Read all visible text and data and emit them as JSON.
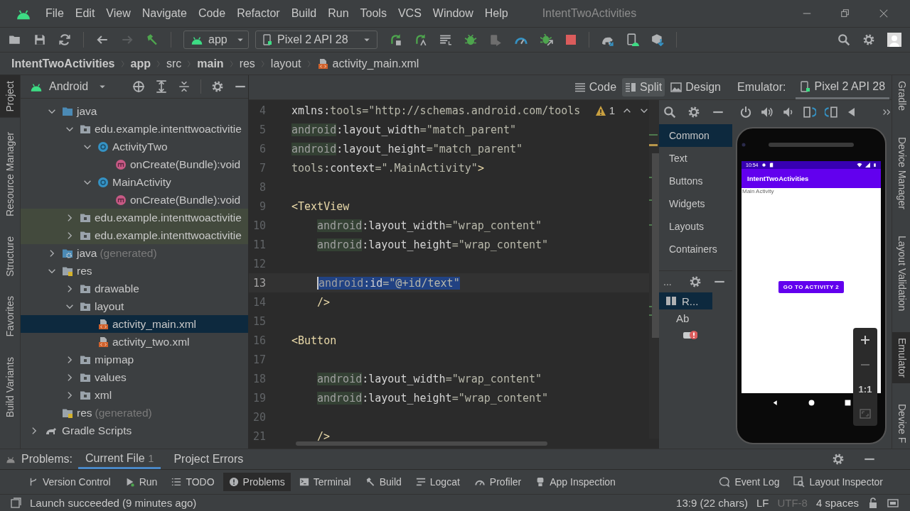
{
  "window": {
    "title": "IntentTwoActivities",
    "menu": [
      "File",
      "Edit",
      "View",
      "Navigate",
      "Code",
      "Refactor",
      "Build",
      "Run",
      "Tools",
      "VCS",
      "Window",
      "Help"
    ]
  },
  "toolbar": {
    "run_config": "app",
    "device": "Pixel 2 API 28"
  },
  "breadcrumb": [
    {
      "text": "IntentTwoActivities",
      "bold": true
    },
    {
      "text": "app",
      "bold": true
    },
    {
      "text": "src",
      "bold": false
    },
    {
      "text": "main",
      "bold": true
    },
    {
      "text": "res",
      "bold": false
    },
    {
      "text": "layout",
      "bold": false
    },
    {
      "text": "activity_main.xml",
      "bold": false,
      "kind": "xml"
    }
  ],
  "left_tabs": [
    {
      "label": "Project",
      "selected": true
    },
    {
      "label": "Resource Manager",
      "selected": false
    },
    {
      "label": "Structure",
      "selected": false
    },
    {
      "label": "Favorites",
      "selected": false
    },
    {
      "label": "Build Variants",
      "selected": false
    }
  ],
  "project": {
    "view": "Android",
    "tree": [
      {
        "children": [
          {
            "label": "java",
            "kind": "folder",
            "expanded": true,
            "selected": false,
            "children": [
              {
                "label": "edu.example.intenttwoactivitie",
                "kind": "package",
                "expanded": true,
                "selected": false,
                "children": [
                  {
                    "label": "ActivityTwo",
                    "kind": "class",
                    "expanded": true,
                    "selected": false,
                    "children": [
                      {
                        "label": "onCreate(Bundle):void",
                        "kind": "method",
                        "selected": false
                      }
                    ]
                  },
                  {
                    "label": "MainActivity",
                    "kind": "class",
                    "expanded": true,
                    "selected": false,
                    "children": [
                      {
                        "label": "onCreate(Bundle):void",
                        "kind": "method",
                        "selected": false
                      }
                    ]
                  }
                ]
              },
              {
                "label": "edu.example.intenttwoactivitie",
                "kind": "test_package",
                "expanded": false,
                "selected": false
              },
              {
                "label": "edu.example.intenttwoactivitie",
                "kind": "test_package",
                "expanded": false,
                "selected": false
              }
            ]
          },
          {
            "label": "java",
            "note": "(generated)",
            "kind": "generated_folder",
            "expanded": false,
            "selected": false
          },
          {
            "label": "res",
            "kind": "res_folder",
            "expanded": true,
            "selected": false,
            "children": [
              {
                "label": "drawable",
                "kind": "package",
                "expanded": false,
                "selected": false
              },
              {
                "label": "layout",
                "kind": "package",
                "expanded": true,
                "selected": false,
                "children": [
                  {
                    "label": "activity_main.xml",
                    "kind": "xml",
                    "selected": true
                  },
                  {
                    "label": "activity_two.xml",
                    "kind": "xml",
                    "selected": false
                  }
                ]
              },
              {
                "label": "mipmap",
                "kind": "package",
                "expanded": false,
                "selected": false
              },
              {
                "label": "values",
                "kind": "package",
                "expanded": false,
                "selected": false
              },
              {
                "label": "xml",
                "kind": "package",
                "expanded": false,
                "selected": false
              }
            ]
          },
          {
            "label": "res",
            "note": "(generated)",
            "kind": "res_folder",
            "selected": false
          }
        ]
      },
      {
        "label": "Gradle Scripts",
        "kind": "gradle",
        "expanded": false,
        "selected": false
      }
    ]
  },
  "editor": {
    "view_modes": [
      {
        "label": "Code",
        "kind": "code",
        "selected": false
      },
      {
        "label": "Split",
        "kind": "split",
        "selected": true
      },
      {
        "label": "Design",
        "kind": "design",
        "selected": false
      }
    ],
    "warnings": "1",
    "lines": [
      {
        "number": "4",
        "selected": false,
        "tokens": [
          {
            "kind": "attr",
            "text": "xmlns:"
          },
          {
            "kind": "value",
            "text": "tools=\"http://schemas.android.com/tools"
          }
        ]
      },
      {
        "number": "5",
        "selected": false,
        "tokens": [
          {
            "kind": "ns",
            "text": "android"
          },
          {
            "kind": "attr",
            "text": ":layout_width"
          },
          {
            "kind": "value",
            "text": "=\"match_parent\""
          }
        ]
      },
      {
        "number": "6",
        "selected": false,
        "tokens": [
          {
            "kind": "ns",
            "text": "android"
          },
          {
            "kind": "attr",
            "text": ":layout_height"
          },
          {
            "kind": "value",
            "text": "=\"match_parent\""
          }
        ]
      },
      {
        "number": "7",
        "selected": false,
        "tokens": [
          {
            "kind": "value",
            "text": "tools"
          },
          {
            "kind": "attr",
            "text": ":context"
          },
          {
            "kind": "value",
            "text": "=\".MainActivity\""
          },
          {
            "kind": "tag",
            "text": ">"
          }
        ]
      },
      {
        "number": "8",
        "selected": false
      },
      {
        "number": "9",
        "selected": false,
        "tokens": [
          {
            "kind": "tag",
            "text": "<TextView"
          }
        ]
      },
      {
        "number": "10",
        "selected": false,
        "indented": true,
        "tokens": [
          {
            "kind": "ns",
            "text": "android"
          },
          {
            "kind": "attr",
            "text": ":layout_width"
          },
          {
            "kind": "value",
            "text": "=\"wrap_content\""
          }
        ]
      },
      {
        "number": "11",
        "selected": false,
        "indented": true,
        "tokens": [
          {
            "kind": "ns",
            "text": "android"
          },
          {
            "kind": "attr",
            "text": ":layout_height"
          },
          {
            "kind": "value",
            "text": "=\"wrap_content\""
          }
        ]
      },
      {
        "number": "12",
        "selected": false
      },
      {
        "number": "13",
        "selected": true,
        "indented": true,
        "tokens": [
          {
            "kind": "ns",
            "text": "android"
          },
          {
            "kind": "attr",
            "text": ":id"
          },
          {
            "kind": "value",
            "text": "=\"@+id/text\""
          }
        ]
      },
      {
        "number": "14",
        "selected": false,
        "indented": true,
        "tokens": [
          {
            "kind": "tag",
            "text": "/>"
          }
        ]
      },
      {
        "number": "15",
        "selected": false
      },
      {
        "number": "16",
        "selected": false,
        "tokens": [
          {
            "kind": "tag",
            "text": "<Button"
          }
        ]
      },
      {
        "number": "17",
        "selected": false
      },
      {
        "number": "18",
        "selected": false,
        "indented": true,
        "tokens": [
          {
            "kind": "ns",
            "text": "android"
          },
          {
            "kind": "attr",
            "text": ":layout_width"
          },
          {
            "kind": "value",
            "text": "=\"wrap_content\""
          }
        ]
      },
      {
        "number": "19",
        "selected": false,
        "indented": true,
        "tokens": [
          {
            "kind": "ns",
            "text": "android"
          },
          {
            "kind": "attr",
            "text": ":layout_height"
          },
          {
            "kind": "value",
            "text": "=\"wrap_content\""
          }
        ]
      },
      {
        "number": "20",
        "selected": false
      },
      {
        "number": "21",
        "selected": false,
        "indented": true,
        "tokens": [
          {
            "kind": "tag",
            "text": "/>"
          }
        ]
      }
    ]
  },
  "palette": {
    "categories": [
      {
        "label": "Common",
        "selected": true
      },
      {
        "label": "Text",
        "selected": false
      },
      {
        "label": "Buttons",
        "selected": false
      },
      {
        "label": "Widgets",
        "selected": false
      },
      {
        "label": "Layouts",
        "selected": false
      },
      {
        "label": "Containers",
        "selected": false
      }
    ],
    "tree_header": "...",
    "components": [
      {
        "kind": "layout",
        "label": "R...",
        "selected": true
      },
      {
        "kind": "text",
        "label": "Ab",
        "selected": false
      },
      {
        "kind": "button_error",
        "selected": false
      }
    ]
  },
  "emulator": {
    "label": "Emulator:",
    "tabs": [
      {
        "label": "Pixel 2 API 28",
        "selected": true
      }
    ],
    "phone": {
      "time": "10:54",
      "app_title": "IntentTwoActivities",
      "text": "Main Activity",
      "button": "GO TO ACTIVITY 2"
    },
    "zoom_label": "1:1"
  },
  "right_tabs": [
    {
      "label": "Gradle",
      "selected": false
    },
    {
      "label": "Device Manager",
      "selected": false
    },
    {
      "label": "Layout Validation",
      "selected": false
    },
    {
      "label": "Emulator",
      "selected": true
    },
    {
      "label": "Device F",
      "selected": false
    }
  ],
  "problems": {
    "label": "Problems:",
    "tabs": [
      {
        "label": "Current File",
        "count": "1",
        "selected": true
      },
      {
        "label": "Project Errors",
        "selected": false
      }
    ]
  },
  "tool_windows": [
    {
      "label": "Version Control",
      "kind": "vcs",
      "selected": false
    },
    {
      "label": "Run",
      "kind": "run",
      "selected": false
    },
    {
      "label": "TODO",
      "kind": "todo",
      "selected": false
    },
    {
      "label": "Problems",
      "kind": "problems",
      "selected": true
    },
    {
      "label": "Terminal",
      "kind": "terminal",
      "selected": false
    },
    {
      "label": "Build",
      "kind": "build",
      "selected": false
    },
    {
      "label": "Logcat",
      "kind": "logcat",
      "selected": false
    },
    {
      "label": "Profiler",
      "kind": "profiler",
      "selected": false
    },
    {
      "label": "App Inspection",
      "kind": "inspection",
      "selected": false
    }
  ],
  "tool_windows_right": [
    {
      "label": "Event Log",
      "kind": "eventlog",
      "selected": false
    },
    {
      "label": "Layout Inspector",
      "kind": "inspector",
      "selected": false
    }
  ],
  "status_bar": {
    "message": "Launch succeeded (9 minutes ago)",
    "items": [
      {
        "text": "13:9 (22 chars)",
        "disabled": false
      },
      {
        "text": "LF",
        "disabled": false
      },
      {
        "text": "UTF-8",
        "disabled": true
      },
      {
        "text": "4 spaces",
        "disabled": false
      }
    ]
  }
}
